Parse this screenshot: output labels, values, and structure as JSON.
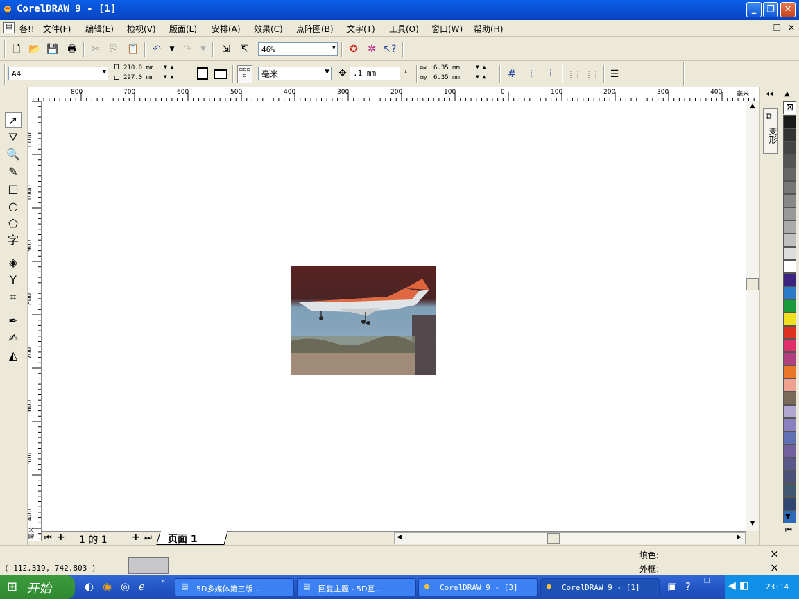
{
  "window": {
    "title": "CorelDRAW 9 - [1]"
  },
  "menu": [
    "各!!",
    "文件(F)",
    "编辑(E)",
    "检视(V)",
    "版面(L)",
    "安排(A)",
    "效果(C)",
    "点阵图(B)",
    "文字(T)",
    "工具(O)",
    "窗口(W)",
    "帮助(H)"
  ],
  "toolbar": {
    "zoom": "46%"
  },
  "propbar": {
    "paper": "A4",
    "width": "210.0 mm",
    "height": "297.0 mm",
    "units": "毫米",
    "nudge": ".1 mm",
    "dup_x": "6.35 mm",
    "dup_y": "6.35 mm"
  },
  "hruler": {
    "unit": "毫米",
    "labels": [
      "800",
      "700",
      "600",
      "500",
      "400",
      "300",
      "200",
      "100",
      "0",
      "100",
      "200",
      "300",
      "400"
    ]
  },
  "vruler": {
    "unit": "毫米",
    "labels": [
      "1100",
      "1000",
      "900",
      "800",
      "700",
      "600",
      "500",
      "400"
    ]
  },
  "pagebar": {
    "counter": "1 的 1",
    "tab": "页面 1"
  },
  "status": {
    "coords": "( 112.319, 742.803 )",
    "fill_label": "填色:",
    "outline_label": "外框:"
  },
  "docker": {
    "tab": "变形"
  },
  "palette": [
    "#1a1a1a",
    "#333333",
    "#444444",
    "#555555",
    "#666666",
    "#777777",
    "#888888",
    "#999999",
    "#aaaaaa",
    "#c0c0c0",
    "#dddddd",
    "#ffffff",
    "#3a2480",
    "#2a7ac8",
    "#1a9a3a",
    "#f0e020",
    "#e03020",
    "#e0306a",
    "#b04080",
    "#e87828",
    "#f0a090",
    "#7a6a5a",
    "#b0a8d0",
    "#8a80c0",
    "#6070b0",
    "#7060a0",
    "#5a5888",
    "#4a5078",
    "#405870",
    "#304870",
    "#2a6ab8"
  ],
  "taskbar": {
    "start": "开始",
    "tasks": [
      "5D多媒体第三版 ...",
      "回复主题 - 5D互...",
      "CorelDRAW 9 - [3]",
      "CorelDRAW 9 - [1]"
    ],
    "clock": "23:14"
  }
}
